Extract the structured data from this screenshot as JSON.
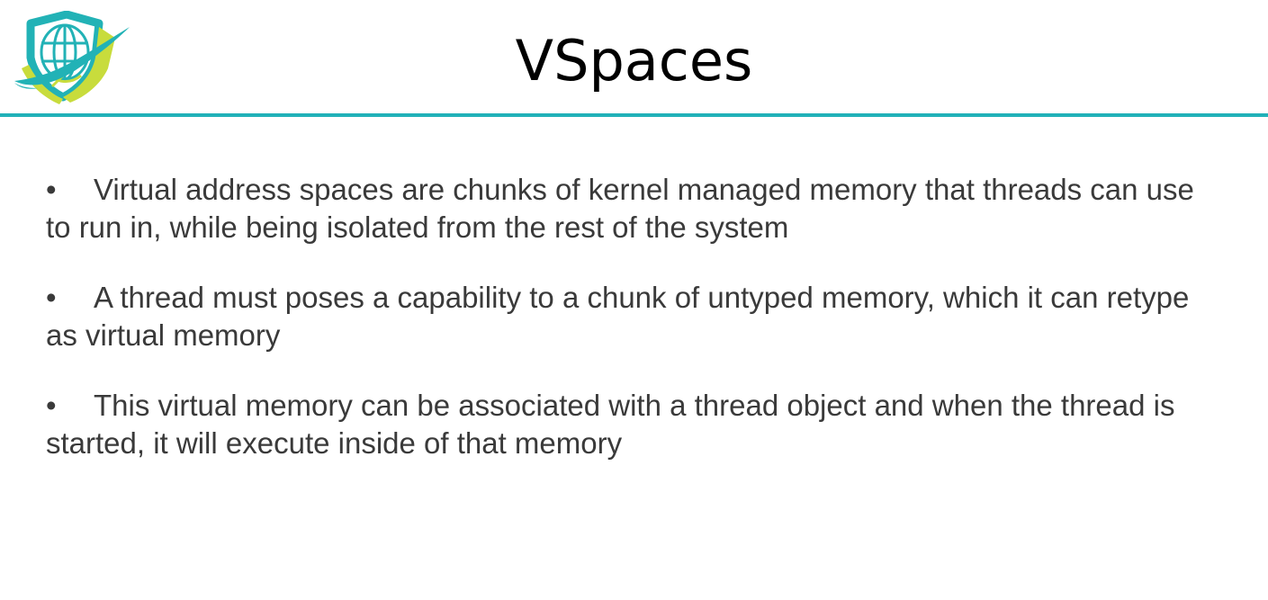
{
  "slide": {
    "title": "VSpaces",
    "logo": {
      "icon": "globe-shield-icon"
    },
    "colors": {
      "accent_rule": "#21b1b8",
      "logo_teal": "#22b2b6",
      "logo_lime": "#c8dc3c",
      "title_text": "#000000",
      "body_text": "#3a3a3a"
    },
    "bullet_marker": "•",
    "bullets": [
      {
        "text": "Virtual address spaces are chunks of kernel managed memory that threads can use to run in, while being isolated from the rest of the system"
      },
      {
        "text": "A thread must poses a capability to a chunk of untyped memory, which it can retype as virtual memory"
      },
      {
        "text": "This virtual memory can be associated with a thread object and when the thread is started, it will execute inside of that memory"
      }
    ]
  }
}
